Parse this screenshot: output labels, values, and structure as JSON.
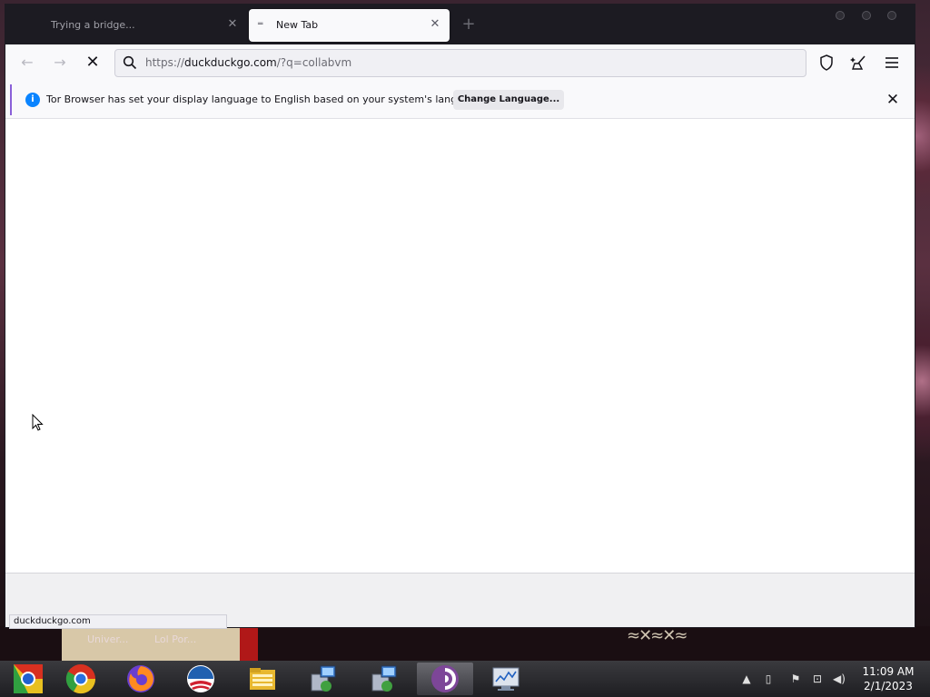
{
  "tabs": [
    {
      "title": "Trying a bridge...",
      "active": false
    },
    {
      "title": "New Tab",
      "active": true
    }
  ],
  "navbar": {
    "url_prefix": "https://",
    "url_host": "duckduckgo.com",
    "url_path": "/?q=collabvm"
  },
  "notification": {
    "message": "Tor Browser has set your display language to English based on your system's language.",
    "button_label": "Change Language..."
  },
  "statusbar": {
    "text": "duckduckgo.com"
  },
  "desktop": {
    "labels": [
      "Univer...",
      "Lol Por..."
    ]
  },
  "taskbar": {
    "apps": [
      "chrome-icon-legacy",
      "chrome-icon",
      "firefox-icon",
      "obama-logo-icon",
      "file-explorer-icon",
      "network-installer-icon",
      "network-installer-icon",
      "tor-browser-icon",
      "performance-monitor-icon"
    ],
    "time": "11:09 AM",
    "date": "2/1/2023"
  },
  "colors": {
    "accent": "#0a84ff",
    "notification_border": "#8a60d8",
    "titlebar": "#1c1b22",
    "tor_purple": "#7d4698"
  }
}
